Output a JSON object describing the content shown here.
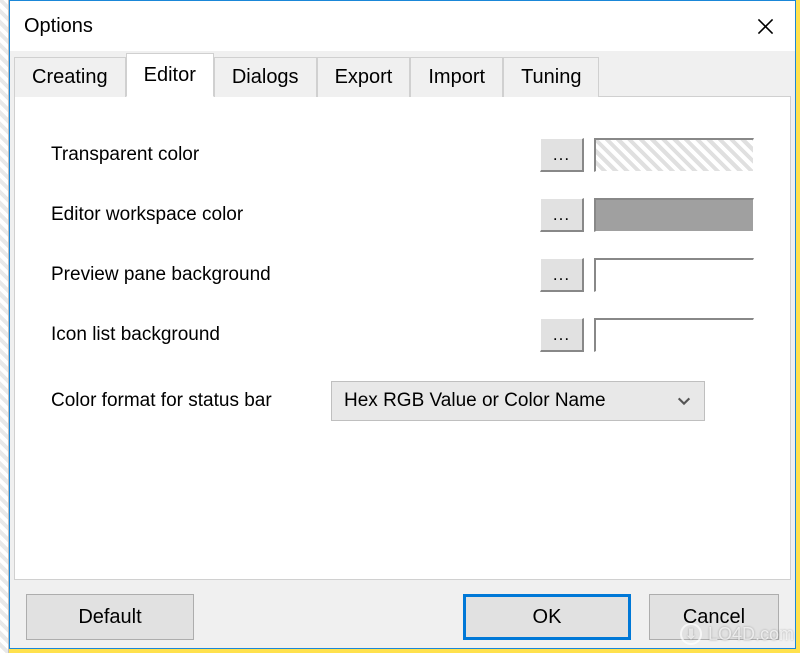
{
  "window": {
    "title": "Options"
  },
  "tabs": [
    {
      "label": "Creating"
    },
    {
      "label": "Editor"
    },
    {
      "label": "Dialogs"
    },
    {
      "label": "Export"
    },
    {
      "label": "Import"
    },
    {
      "label": "Tuning"
    }
  ],
  "active_tab_index": 1,
  "editor_options": {
    "rows": [
      {
        "label": "Transparent color",
        "swatch": "hatch",
        "ellipsis": "..."
      },
      {
        "label": "Editor workspace color",
        "swatch": "gray",
        "ellipsis": "..."
      },
      {
        "label": "Preview pane background",
        "swatch": "white",
        "ellipsis": "..."
      },
      {
        "label": "Icon list background",
        "swatch": "white",
        "ellipsis": "..."
      }
    ],
    "combo_label": "Color format for status bar",
    "combo_value": "Hex RGB Value or Color Name"
  },
  "buttons": {
    "default": "Default",
    "ok": "OK",
    "cancel": "Cancel"
  },
  "watermark": "LO4D.com"
}
